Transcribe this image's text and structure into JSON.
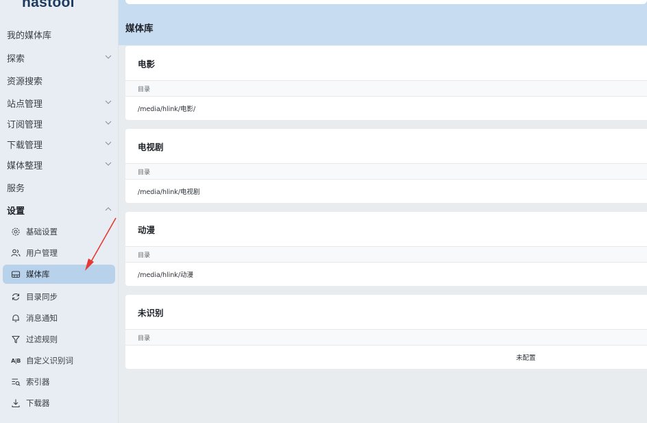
{
  "app": {
    "logo": "nastool"
  },
  "sidebar": {
    "items": [
      {
        "label": "我的媒体库",
        "chevron": "none"
      },
      {
        "label": "探索",
        "chevron": "down"
      },
      {
        "label": "资源搜索",
        "chevron": "none"
      },
      {
        "label": "站点管理",
        "chevron": "down"
      },
      {
        "label": "订阅管理",
        "chevron": "down"
      },
      {
        "label": "下载管理",
        "chevron": "down"
      },
      {
        "label": "媒体整理",
        "chevron": "down"
      },
      {
        "label": "服务",
        "chevron": "none"
      },
      {
        "label": "设置",
        "chevron": "up"
      }
    ],
    "settings_items": [
      {
        "label": "基础设置",
        "icon": "gear-icon"
      },
      {
        "label": "用户管理",
        "icon": "users-icon"
      },
      {
        "label": "媒体库",
        "icon": "library-icon",
        "active": true
      },
      {
        "label": "目录同步",
        "icon": "sync-icon"
      },
      {
        "label": "消息通知",
        "icon": "bell-icon"
      },
      {
        "label": "过滤规则",
        "icon": "filter-icon"
      },
      {
        "label": "自定义识别词",
        "icon": "ab-icon",
        "icon_text": "A|B"
      },
      {
        "label": "索引器",
        "icon": "indexer-icon"
      },
      {
        "label": "下载器",
        "icon": "download-icon"
      }
    ]
  },
  "main": {
    "title": "媒体库",
    "cards": [
      {
        "title": "电影",
        "column": "目录",
        "value": "/media/hlink/电影/"
      },
      {
        "title": "电视剧",
        "column": "目录",
        "value": "/media/hlink/电视剧"
      },
      {
        "title": "动漫",
        "column": "目录",
        "value": "/media/hlink/动漫"
      },
      {
        "title": "未识别",
        "column": "目录",
        "value": "未配置"
      }
    ]
  },
  "colors": {
    "sidebar_bg": "#e8edf3",
    "active_bg": "#b8d2ec",
    "banner_bg": "#c7dbf1",
    "annotation_arrow": "#e53935"
  }
}
